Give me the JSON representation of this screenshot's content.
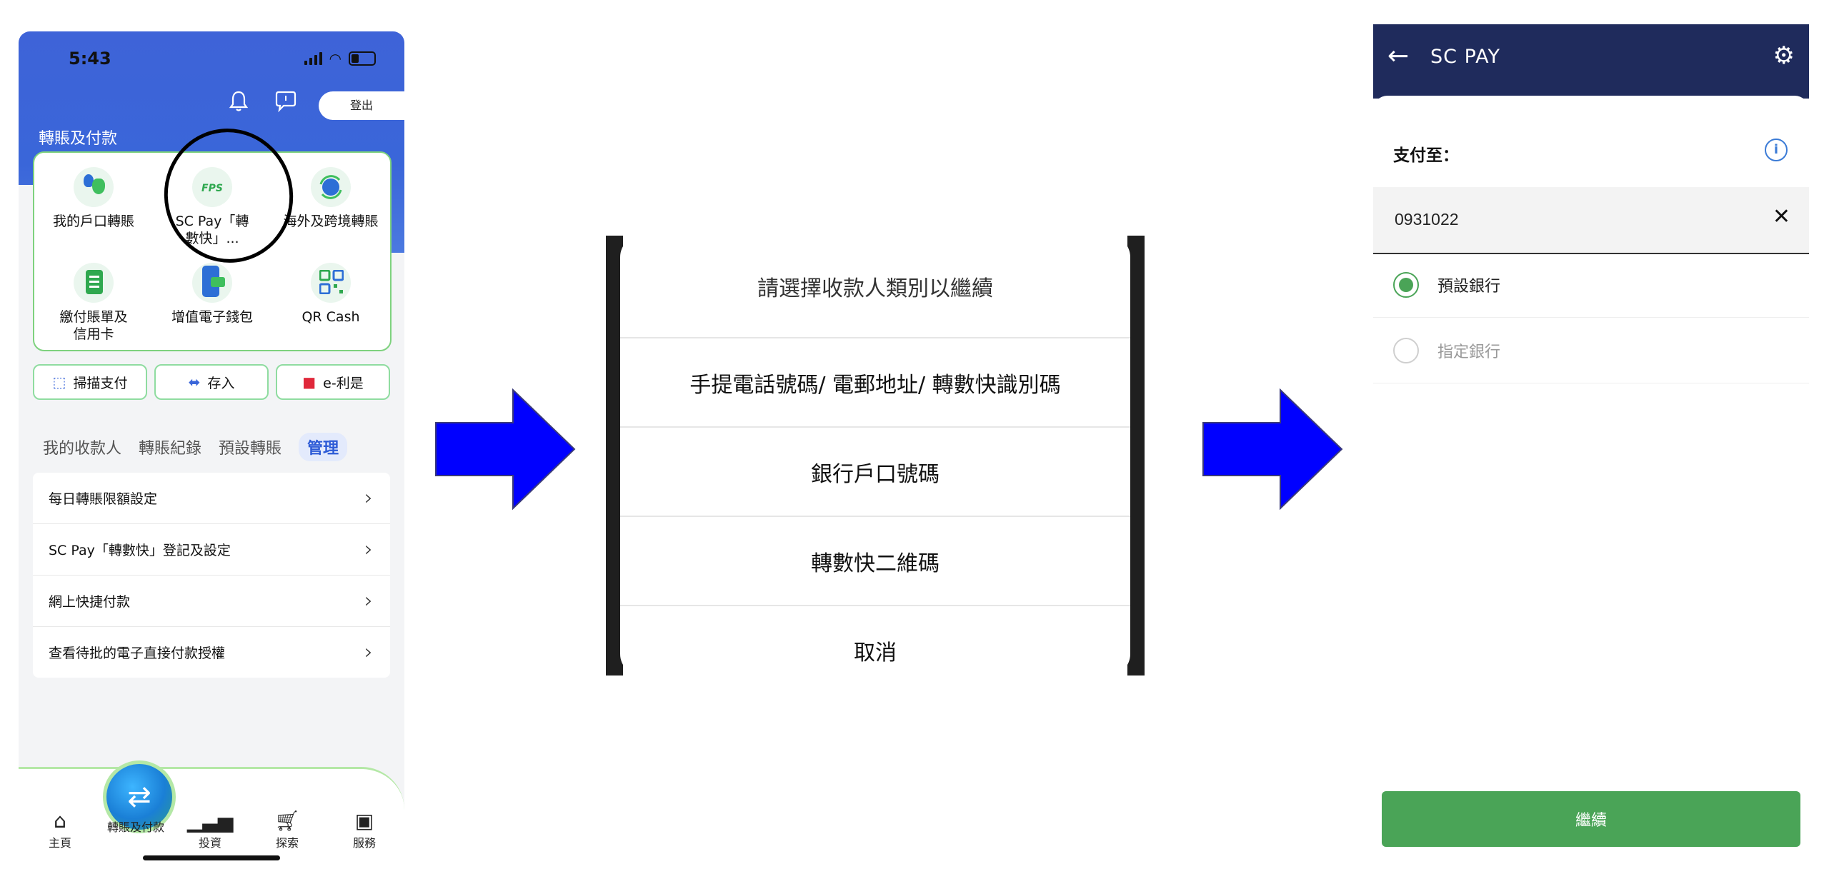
{
  "phone1": {
    "status_time": "5:43",
    "logout_label": "登出",
    "section_title": "轉賬及付款",
    "grid_items": [
      {
        "label": "我的戶口轉賬"
      },
      {
        "label": "SC Pay「轉\n數快」..."
      },
      {
        "label": "海外及跨境轉賬"
      },
      {
        "label": "繳付賬單及\n信用卡"
      },
      {
        "label": "增值電子錢包"
      },
      {
        "label": "QR Cash"
      }
    ],
    "fps_badge": "FPS",
    "quick_actions": [
      {
        "label": "掃描支付"
      },
      {
        "label": "存入"
      },
      {
        "label": "e-利是"
      }
    ],
    "tabs": [
      "我的收款人",
      "轉賬紀錄",
      "預設轉賬",
      "管理"
    ],
    "active_tab": "管理",
    "menu": [
      {
        "label": "每日轉賬限額設定"
      },
      {
        "label": "SC Pay「轉數快」登記及設定"
      },
      {
        "label": "網上快捷付款"
      },
      {
        "label": "查看待批的電子直接付款授權"
      }
    ],
    "nav": [
      {
        "label": "主頁"
      },
      {
        "label": "轉賬及付款"
      },
      {
        "label": "投資"
      },
      {
        "label": "探索"
      },
      {
        "label": "服務"
      }
    ]
  },
  "dialog": {
    "title": "請選擇收款人類別以繼續",
    "options": [
      {
        "label": "手提電話號碼/ 電郵地址/ 轉數快識別碼"
      },
      {
        "label": "銀行戶口號碼"
      },
      {
        "label": "轉數快二維碼"
      },
      {
        "label": "取消"
      }
    ]
  },
  "phone3": {
    "title": "SC PAY",
    "pay_to_label": "支付至：",
    "input_value": "0931022",
    "radio_options": [
      {
        "label": "預設銀行",
        "selected": true
      },
      {
        "label": "指定銀行",
        "selected": false
      }
    ],
    "continue_label": "繼續"
  },
  "colors": {
    "header_blue": "#3a66d9",
    "navy": "#1f2b5c",
    "green": "#4aa457",
    "arrow_blue": "#0000ff"
  }
}
